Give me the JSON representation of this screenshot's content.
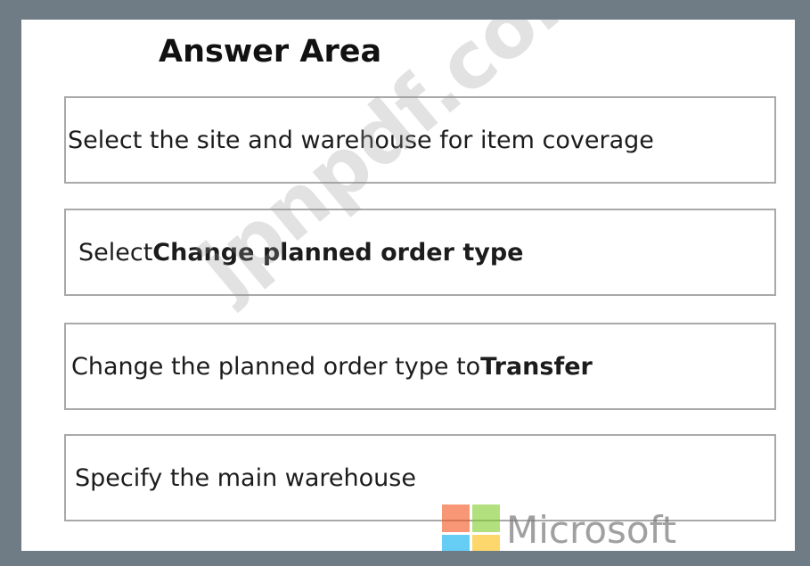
{
  "answer_area": {
    "heading": "Answer Area",
    "steps": [
      {
        "text": "Select the site and warehouse for item coverage",
        "bold": ""
      },
      {
        "text": "Select ",
        "bold": "Change planned order type"
      },
      {
        "text": "Change the planned order type to ",
        "bold": "Transfer"
      },
      {
        "text": "Specify the main warehouse",
        "bold": ""
      }
    ]
  },
  "watermark": {
    "text": "jpnpdf.com",
    "logo_name": "microsoft-logo",
    "logo_text": "Microsoft",
    "logo_colors": [
      "#f1511b",
      "#80cc28",
      "#00adef",
      "#fbbc09"
    ]
  },
  "colors": {
    "frame": "#6f7c86",
    "panel": "#ffffff",
    "box_border": "#a9a9a9"
  }
}
